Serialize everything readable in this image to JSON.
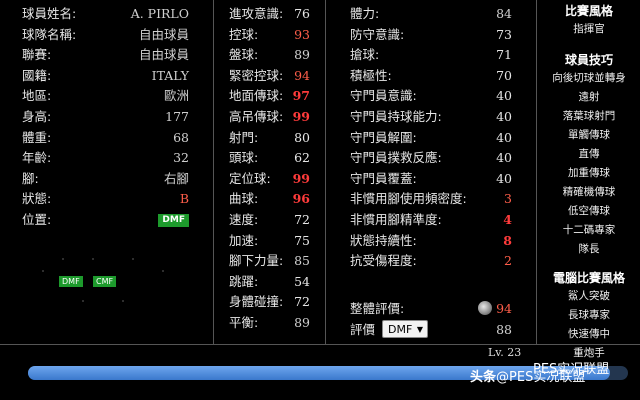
{
  "profile": [
    {
      "label": "球員姓名:",
      "value": "A. PIRLO"
    },
    {
      "label": "球隊名稱:",
      "value": "自由球員"
    },
    {
      "label": "聯賽:",
      "value": "自由球員"
    },
    {
      "label": "國籍:",
      "value": "ITALY"
    },
    {
      "label": "地區:",
      "value": "歐洲"
    },
    {
      "label": "身高:",
      "value": "177"
    },
    {
      "label": "體重:",
      "value": "68"
    },
    {
      "label": "年齡:",
      "value": "32"
    },
    {
      "label": "腳:",
      "value": "右腳"
    },
    {
      "label": "狀態:",
      "value": "B"
    },
    {
      "label": "位置:",
      "value": "DMF"
    }
  ],
  "mini_positions": [
    "DMF",
    "CMF"
  ],
  "stats_a": [
    {
      "label": "進攻意識:",
      "value": "76",
      "tone": "white"
    },
    {
      "label": "控球:",
      "value": "93",
      "tone": "orange"
    },
    {
      "label": "盤球:",
      "value": "89",
      "tone": "dim"
    },
    {
      "label": "緊密控球:",
      "value": "94",
      "tone": "orange"
    },
    {
      "label": "地面傳球:",
      "value": "97",
      "tone": "red"
    },
    {
      "label": "高吊傳球:",
      "value": "99",
      "tone": "red"
    },
    {
      "label": "射門:",
      "value": "80",
      "tone": "white"
    },
    {
      "label": "頭球:",
      "value": "62",
      "tone": "white"
    },
    {
      "label": "定位球:",
      "value": "99",
      "tone": "red"
    },
    {
      "label": "曲球:",
      "value": "96",
      "tone": "red"
    },
    {
      "label": "速度:",
      "value": "72",
      "tone": "white"
    },
    {
      "label": "加速:",
      "value": "75",
      "tone": "white"
    },
    {
      "label": "腳下力量:",
      "value": "85",
      "tone": "dim"
    },
    {
      "label": "跳躍:",
      "value": "54",
      "tone": "white"
    },
    {
      "label": "身體碰撞:",
      "value": "72",
      "tone": "white"
    },
    {
      "label": "平衡:",
      "value": "89",
      "tone": "dim"
    }
  ],
  "stats_b": [
    {
      "label": "體力:",
      "value": "84",
      "tone": "dim"
    },
    {
      "label": "防守意識:",
      "value": "73",
      "tone": "white"
    },
    {
      "label": "搶球:",
      "value": "71",
      "tone": "white"
    },
    {
      "label": "積極性:",
      "value": "70",
      "tone": "white"
    },
    {
      "label": "守門員意識:",
      "value": "40",
      "tone": "white"
    },
    {
      "label": "守門員持球能力:",
      "value": "40",
      "tone": "white"
    },
    {
      "label": "守門員解圍:",
      "value": "40",
      "tone": "white"
    },
    {
      "label": "守門員撲救反應:",
      "value": "40",
      "tone": "white"
    },
    {
      "label": "守門員覆蓋:",
      "value": "40",
      "tone": "white"
    },
    {
      "label": "非慣用腳使用頻密度:",
      "value": "3",
      "tone": "orange"
    },
    {
      "label": "非慣用腳精準度:",
      "value": "4",
      "tone": "red"
    },
    {
      "label": "狀態持續性:",
      "value": "8",
      "tone": "red"
    },
    {
      "label": "抗受傷程度:",
      "value": "2",
      "tone": "orange"
    }
  ],
  "overall": {
    "label": "整體評價:",
    "value": "94"
  },
  "rating": {
    "label": "評價",
    "selected": "DMF",
    "value": "88"
  },
  "sidebar": {
    "style_title": "比賽風格",
    "style_items": [
      "指揮官"
    ],
    "skills_title": "球員技巧",
    "skills_items": [
      "向後切球並轉身",
      "遠射",
      "落葉球射門",
      "單觸傳球",
      "直傳",
      "加重傳球",
      "精確機傳球",
      "低空傳球",
      "十二碼專家",
      "隊長"
    ],
    "ai_title": "電腦比賽風格",
    "ai_items": [
      "鯊人突破",
      "長球專家",
      "快速傳中",
      "重炮手"
    ]
  },
  "level": {
    "label": "Lv. 23",
    "progress": 0.97
  },
  "watermark": {
    "text1": "头条",
    "text2": "@PES实况联盟",
    "text3": "PES实况联盟"
  }
}
